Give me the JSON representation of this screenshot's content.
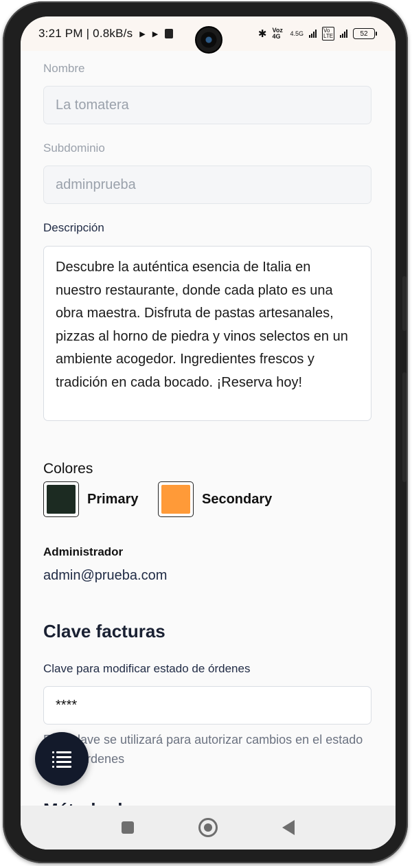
{
  "status_bar": {
    "time": "3:21 PM | 0.8kB/s",
    "network_label": "Voz 4G",
    "network_type": "4.5G",
    "volte_label": "Vo LTE",
    "battery": "52"
  },
  "form": {
    "name": {
      "label": "Nombre",
      "value": "La tomatera"
    },
    "subdomain": {
      "label": "Subdominio",
      "value": "adminprueba"
    },
    "description": {
      "label": "Descripción",
      "value": "Descubre la auténtica esencia de Italia en nuestro restaurante, donde cada plato es una obra maestra. Disfruta de pastas artesanales, pizzas al horno de piedra y vinos selectos en un ambiente acogedor. Ingredientes frescos y tradición en cada bocado. ¡Reserva hoy!"
    },
    "colors": {
      "title": "Colores",
      "primary": {
        "label": "Primary",
        "color": "#1c2b22"
      },
      "secondary": {
        "label": "Secondary",
        "color": "#ff9a38"
      }
    },
    "admin": {
      "label": "Administrador",
      "email": "admin@prueba.com"
    }
  },
  "invoice_key": {
    "title": "Clave facturas",
    "field_label": "Clave para modificar estado de órdenes",
    "value": "****",
    "help": "Esta clave se utilizará para autorizar cambios en el estado de las órdenes"
  },
  "next_section_title": "Método de pago",
  "fab": {
    "icon": "list-icon"
  },
  "nav": {
    "recents": "square-icon",
    "home": "circle-icon",
    "back": "triangle-icon"
  }
}
